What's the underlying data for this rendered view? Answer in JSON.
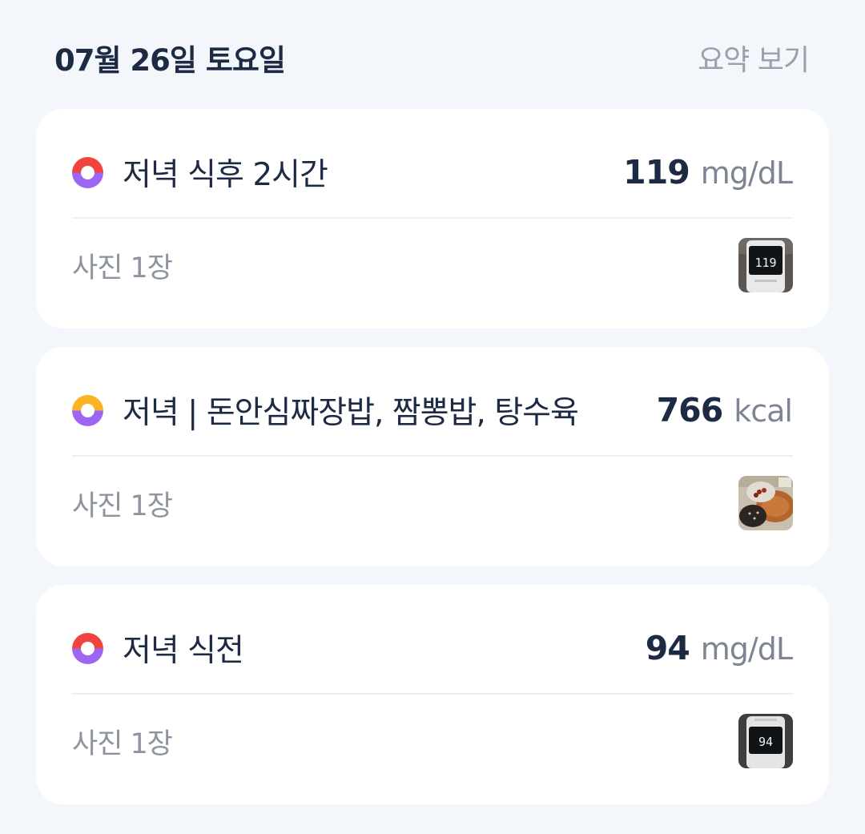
{
  "header": {
    "date": "07월 26일 토요일",
    "summary_link": "요약 보기"
  },
  "entries": [
    {
      "title": "저녁 식후 2시간",
      "value": "119",
      "unit": "mg/dL",
      "photo_label": "사진 1장",
      "dot_color": "#f0453f",
      "thumb_display": "119"
    },
    {
      "title": "저녁 | 돈안심짜장밥, 짬뽕밥, 탕수육",
      "value": "766",
      "unit": "kcal",
      "photo_label": "사진 1장",
      "dot_color": "#fbb224"
    },
    {
      "title": "저녁 식전",
      "value": "94",
      "unit": "mg/dL",
      "photo_label": "사진 1장",
      "dot_color": "#f0453f",
      "thumb_display": "94"
    }
  ],
  "colors": {
    "background": "#f3f6fa",
    "card": "#ffffff",
    "text_primary": "#1d2a44",
    "text_muted": "#8d949e",
    "ring_bottom": "#9d66f2"
  }
}
